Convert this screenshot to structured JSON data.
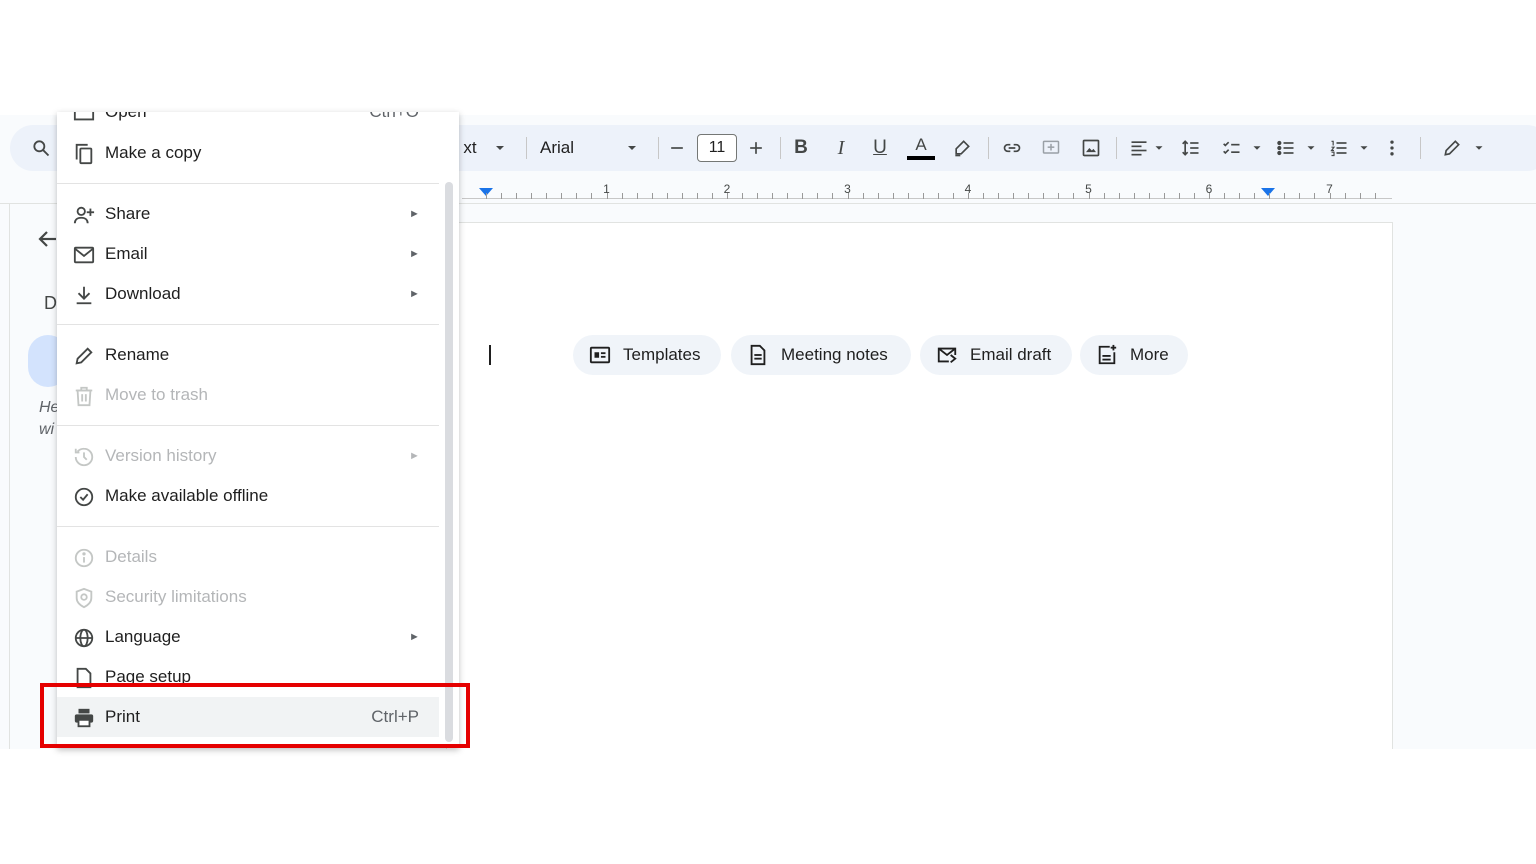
{
  "toolbar": {
    "style_label": "xt",
    "font_name": "Arial",
    "font_size": "11",
    "bold_label": "B",
    "italic_label": "I",
    "underline_label": "U",
    "text_color_label": "A"
  },
  "ruler": {
    "numbers": [
      "1",
      "2",
      "3",
      "4",
      "5",
      "6",
      "7"
    ]
  },
  "left_panel": {
    "heading_initial": "D",
    "hint_line1": "He",
    "hint_line2": "wi"
  },
  "document": {
    "chips": [
      {
        "label": "Templates",
        "icon": "templates-icon"
      },
      {
        "label": "Meeting notes",
        "icon": "document-icon"
      },
      {
        "label": "Email draft",
        "icon": "email-draft-icon"
      },
      {
        "label": "More",
        "icon": "more-add-icon"
      }
    ]
  },
  "file_menu": {
    "items": [
      {
        "label": "Open",
        "shortcut": "Ctrl+O",
        "icon": "folder-icon"
      },
      {
        "label": "Make a copy",
        "icon": "copy-icon"
      },
      {
        "label": "Share",
        "icon": "share-person-icon",
        "submenu": true
      },
      {
        "label": "Email",
        "icon": "mail-icon",
        "submenu": true
      },
      {
        "label": "Download",
        "icon": "download-icon",
        "submenu": true
      },
      {
        "label": "Rename",
        "icon": "pencil-icon"
      },
      {
        "label": "Move to trash",
        "icon": "trash-icon",
        "disabled": true
      },
      {
        "label": "Version history",
        "icon": "history-icon",
        "submenu": true,
        "disabled": true
      },
      {
        "label": "Make available offline",
        "icon": "offline-check-icon"
      },
      {
        "label": "Details",
        "icon": "info-icon",
        "disabled": true
      },
      {
        "label": "Security limitations",
        "icon": "shield-icon",
        "disabled": true
      },
      {
        "label": "Language",
        "icon": "globe-icon",
        "submenu": true
      },
      {
        "label": "Page setup",
        "icon": "page-setup-icon"
      },
      {
        "label": "Print",
        "shortcut": "Ctrl+P",
        "icon": "printer-icon",
        "highlighted": true
      }
    ],
    "submenu_arrow": "►"
  },
  "colors": {
    "highlight_border": "#e50000",
    "toolbar_bg": "#edf2fa",
    "accent": "#1a73e8"
  }
}
